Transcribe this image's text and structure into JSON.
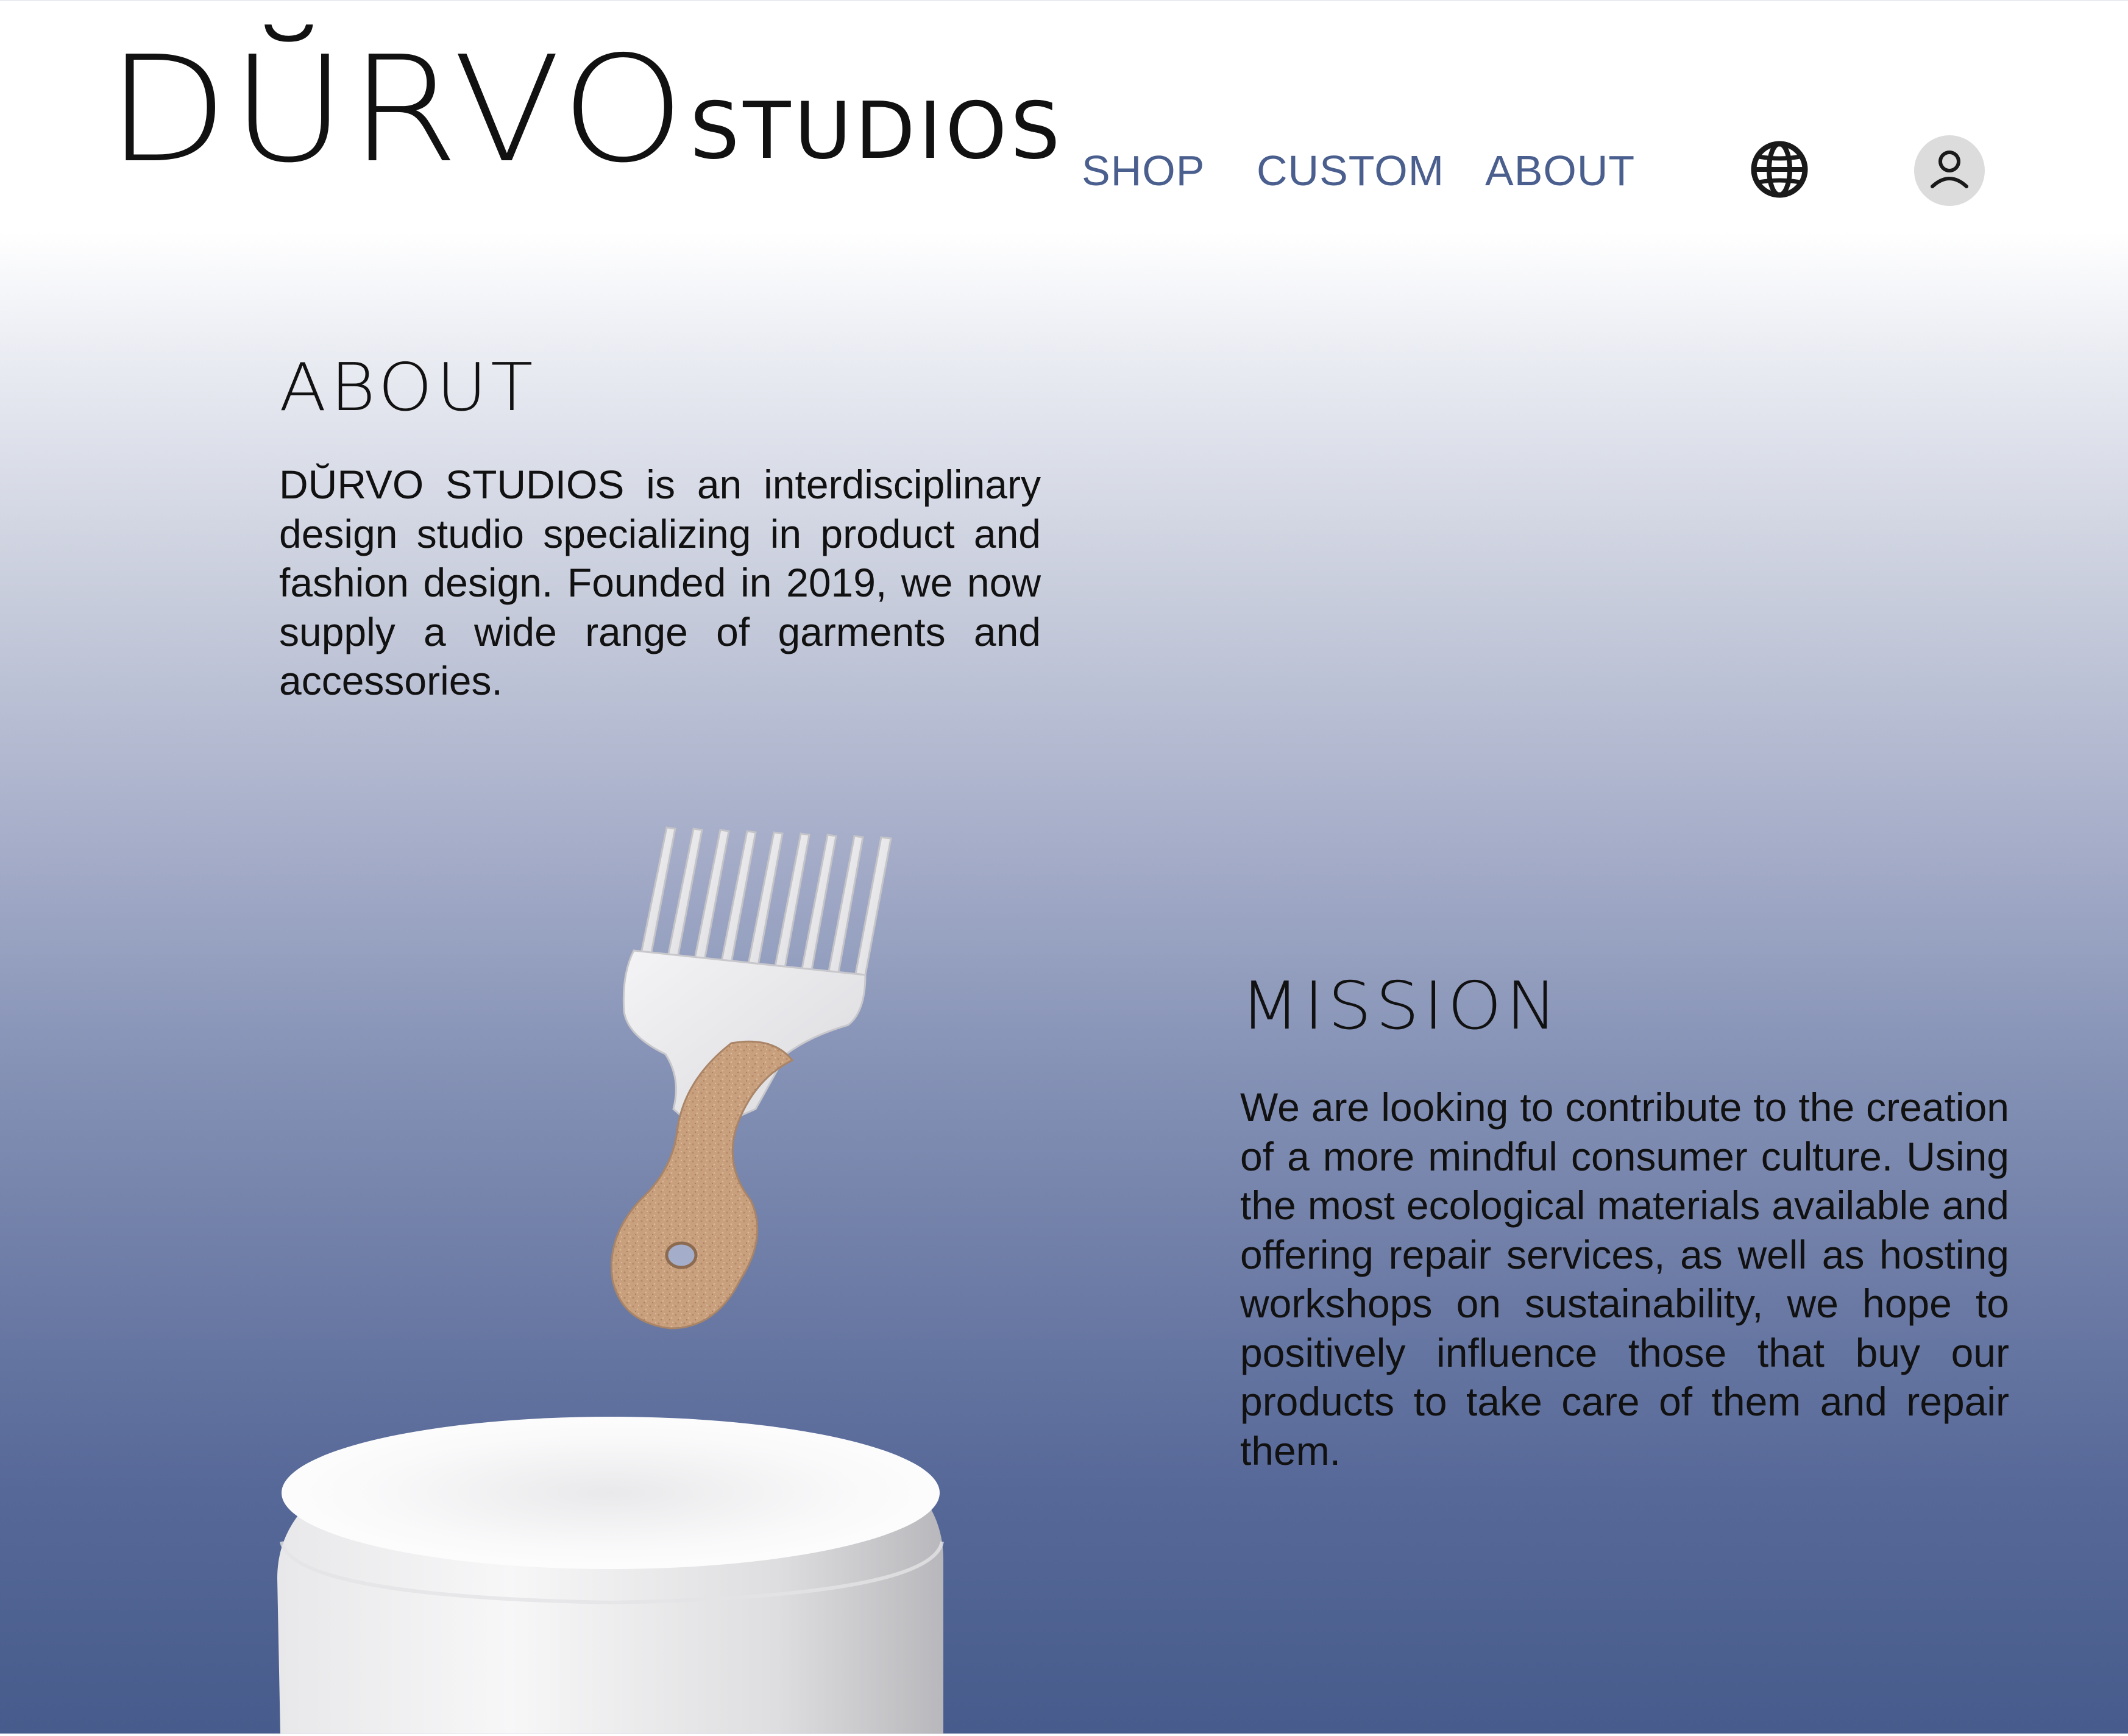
{
  "brand": {
    "mark": "DŬRVO",
    "word": "STUDIOS"
  },
  "nav": {
    "items": [
      {
        "label": "SHOP"
      },
      {
        "label": "CUSTOM"
      },
      {
        "label": "ABOUT"
      }
    ],
    "icons": [
      "globe-icon",
      "user-icon"
    ]
  },
  "about": {
    "title": "ABOUT",
    "body": "DŬRVO STUDIOS is an interdisciplinary design studio specializing in product and fashion design. Founded in 2019, we now supply a wide range of garments and accessories."
  },
  "mission": {
    "title": "MISSION",
    "body": "We are looking to contribute to the creation of a more mindful consumer culture. Using the most ecological materials available and offering repair services, as well as hosting workshops on sustainability, we hope to positively influence those that buy our products to take care of them and repair them."
  },
  "colors": {
    "nav_text": "#4a5f8e",
    "gradient_bottom": "#475c8c",
    "cork": "#c9a07e",
    "comb": "#e6e6e8"
  }
}
